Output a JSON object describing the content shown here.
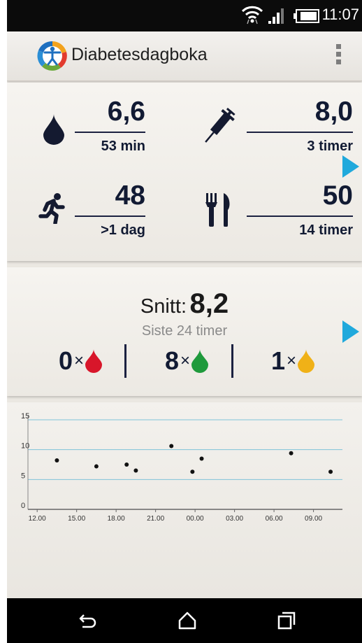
{
  "status_bar": {
    "time": "11:07"
  },
  "action_bar": {
    "title": "Diabetesdagboka"
  },
  "summary": {
    "glucose": {
      "value": "6,6",
      "time": "53 min"
    },
    "insulin": {
      "value": "8,0",
      "time": "3 timer"
    },
    "activity": {
      "value": "48",
      "time": ">1 dag"
    },
    "meal": {
      "value": "50",
      "time": "14 timer"
    }
  },
  "average": {
    "label": "Snitt:",
    "value": "8,2",
    "period": "Siste 24 timer",
    "counts": [
      {
        "count": "0",
        "mult": "×",
        "color": "#d8162a",
        "level": "high"
      },
      {
        "count": "8",
        "mult": "×",
        "color": "#1f9a3c",
        "level": "normal"
      },
      {
        "count": "1",
        "mult": "×",
        "color": "#f0b117",
        "level": "low"
      }
    ]
  },
  "chart_data": {
    "type": "scatter",
    "x_tick_labels": [
      "12.00",
      "15.00",
      "18.00",
      "21.00",
      "00.00",
      "03.00",
      "06.00",
      "09.00"
    ],
    "y_tick_labels": [
      "0",
      "5",
      "10",
      "15"
    ],
    "ylim": [
      0,
      15
    ],
    "xlim_hours": [
      11.3,
      35.2
    ],
    "grid_y": [
      5,
      10,
      15
    ],
    "points": [
      {
        "x": 13.5,
        "y": 8.2
      },
      {
        "x": 16.5,
        "y": 7.2
      },
      {
        "x": 18.8,
        "y": 7.5
      },
      {
        "x": 19.5,
        "y": 6.5
      },
      {
        "x": 22.2,
        "y": 10.6
      },
      {
        "x": 23.8,
        "y": 6.3
      },
      {
        "x": 24.5,
        "y": 8.5
      },
      {
        "x": 31.3,
        "y": 9.4
      },
      {
        "x": 34.3,
        "y": 6.3
      }
    ]
  }
}
